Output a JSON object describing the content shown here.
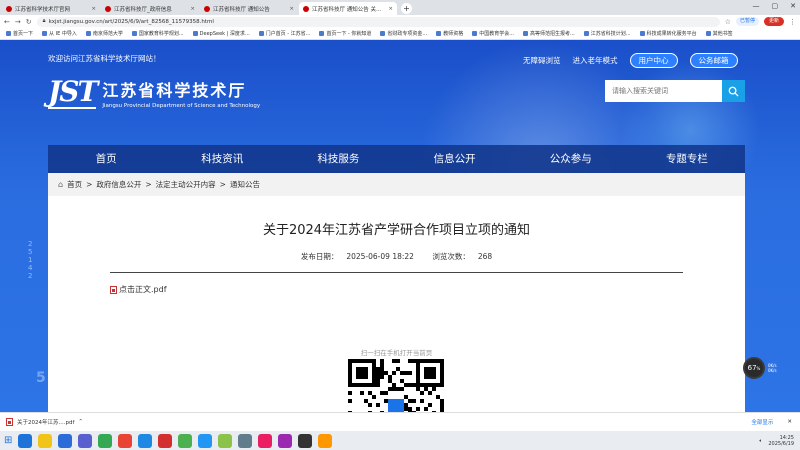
{
  "browser": {
    "tabs": [
      {
        "label": "江苏省科学技术厅官网",
        "active": false
      },
      {
        "label": "江苏省科技厅_政府信息",
        "active": false
      },
      {
        "label": "江苏省科技厅 通知公告",
        "active": false
      },
      {
        "label": "江苏省科技厅 通知公告 关于20...",
        "active": true
      }
    ],
    "url": "kxjst.jiangsu.gov.cn/art/2025/6/9/art_82568_11579358.html",
    "translate_label": "已暂停",
    "update_label": "更新",
    "bookmarks": [
      "首页一下",
      "从 IE 中导入",
      "南京师范大学",
      "国家教育科学规划...",
      "DeepSeek | 深度求...",
      "门户首页 - 江苏省...",
      "首页一下 - 你就知道",
      "省财政专项资金...",
      "教师资格",
      "中国教育学会...",
      "高等师范招生报考...",
      "江苏省科技计划...",
      "科技成果转化服务平台",
      "其他书签"
    ]
  },
  "site": {
    "welcome": "欢迎访问江苏省科学技术厅网站！",
    "top_links": {
      "accessible": "无障碍浏览",
      "elder": "进入老年模式",
      "user_center": "用户中心",
      "mail": "公务邮箱"
    },
    "logo": {
      "mark": "JST",
      "cn": "江苏省科学技术厅",
      "en": "Jiangsu Provincial Department of Science and Technology"
    },
    "search": {
      "placeholder": "请输入搜索关键词"
    },
    "nav": [
      "首页",
      "科技资讯",
      "科技服务",
      "信息公开",
      "公众参与",
      "专题专栏"
    ],
    "breadcrumb": [
      "首页",
      "政府信息公开",
      "法定主动公开内容",
      "通知公告"
    ]
  },
  "article": {
    "title": "关于2024年江苏省产学研合作项目立项的通知",
    "publish_label": "发布日期：",
    "publish_date": "2025-06-09 18:22",
    "views_label": "浏览次数：",
    "views": "268",
    "attachment": "点击正文.pdf",
    "qr_label": "扫一扫在手机打开当前页"
  },
  "speed": {
    "value": "67",
    "unit": "%",
    "up": "0K/s",
    "down": "0K/s"
  },
  "download": {
    "file": "关于2024年江苏....pdf",
    "all_label": "全部显示"
  },
  "taskbar": {
    "time": "14:25",
    "date": "2025/6/19",
    "colors": [
      "#1e73d8",
      "#f0c419",
      "#2c6cd8",
      "#5a5fd0",
      "#34a853",
      "#e94335",
      "#1e88e5",
      "#d32f2f",
      "#4caf50",
      "#2196f3",
      "#8bc34a",
      "#607d8b",
      "#e91e63",
      "#9c27b0",
      "#333333",
      "#ff9800"
    ]
  }
}
